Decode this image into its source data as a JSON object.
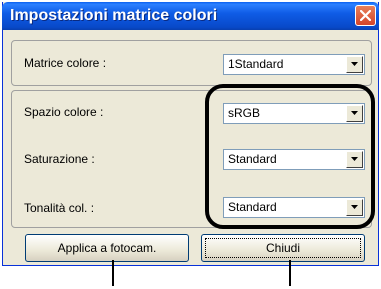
{
  "window": {
    "title": "Impostazioni matrice colori"
  },
  "matrix": {
    "label": "Matrice colore :",
    "value": "1Standard"
  },
  "settings": {
    "color_space_label": "Spazio colore :",
    "color_space_value": "sRGB",
    "saturation_label": "Saturazione :",
    "saturation_value": "Standard",
    "tone_label": "Tonalità col. :",
    "tone_value": "Standard"
  },
  "buttons": {
    "apply_label": "Applica a fotocam.",
    "close_label": "Chiudi"
  },
  "icons": {
    "close": "close-icon",
    "dropdown": "chevron-down-icon"
  },
  "colors": {
    "titlebar": "#0a5be0",
    "close_button": "#d5442a",
    "dialog_bg": "#ece9d8"
  }
}
